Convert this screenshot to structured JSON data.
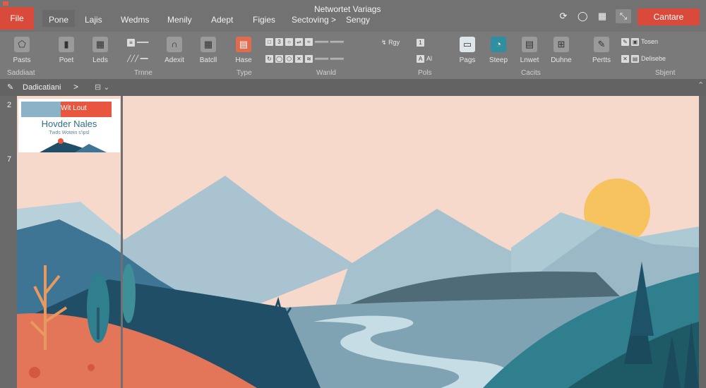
{
  "window": {
    "title": "Networtet Variags",
    "cta_label": "Cantare"
  },
  "menu": {
    "file": "File",
    "tabs": [
      "Pone",
      "Lajis",
      "Wedms",
      "Menily",
      "Adept",
      "Figies",
      "Sectoving >",
      "Sengy"
    ]
  },
  "ribbon": {
    "big_buttons": [
      {
        "label": "Pasts",
        "icon": "pentagon-icon"
      },
      {
        "label": "Poet",
        "icon": "slide-icon"
      },
      {
        "label": "Leds",
        "icon": "grid-icon"
      },
      {
        "label": "Adexit",
        "icon": "headphones-icon"
      },
      {
        "label": "Batcll",
        "icon": "table-icon"
      },
      {
        "label": "Hase",
        "icon": "text-box-icon"
      },
      {
        "label": "Pags",
        "icon": "monitor-icon"
      },
      {
        "label": "Steep",
        "icon": "gauge-icon"
      },
      {
        "label": "Lnwet",
        "icon": "document-icon"
      },
      {
        "label": "Duhne",
        "icon": "puzzle-icon"
      },
      {
        "label": "Pertts",
        "icon": "pen-icon"
      }
    ],
    "small_items": [
      "Rgy",
      "Al",
      "Tosen",
      "Delisebe"
    ],
    "group_labels": [
      "Saddiaat",
      "Trnne",
      "Type",
      "Wanld",
      "Pols",
      "Cacits",
      "Sbjent"
    ]
  },
  "panel": {
    "title": "Dadicatiani",
    "slide_numbers": [
      "2",
      "7"
    ]
  },
  "thumbnail": {
    "tag": "Wit Lout",
    "title": "Hovder Nales",
    "subtitle": "Twds Wotein s'ipsl"
  },
  "colors": {
    "accent": "#d94a3a",
    "sky": "#f7d9cc",
    "sun": "#f6c35f",
    "teal_dark": "#1f4e66",
    "teal_mid": "#2f7f8e",
    "mountain_light": "#a9c4d0",
    "ground_orange": "#e37659"
  }
}
